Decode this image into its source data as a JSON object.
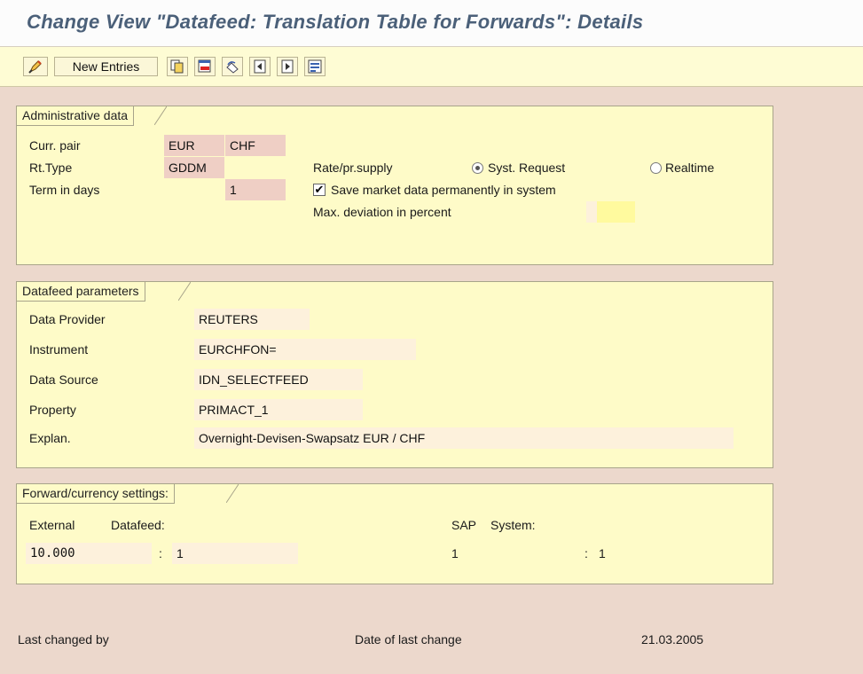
{
  "title": "Change View \"Datafeed: Translation Table for Forwards\": Details",
  "toolbar": {
    "new_entries_label": "New Entries",
    "icons": [
      "display-change-icon",
      "copy-icon",
      "delete-icon",
      "undo-icon",
      "previous-entry-icon",
      "next-entry-icon",
      "select-block-icon"
    ]
  },
  "admin": {
    "title": "Administrative data",
    "curr_pair_label": "Curr. pair",
    "curr_from": "EUR",
    "curr_to": "CHF",
    "rt_type_label": "Rt.Type",
    "rt_type_value": "GDDM",
    "term_label": "Term in days",
    "term_value": "1",
    "rate_supply_label": "Rate/pr.supply",
    "syst_request_label": "Syst. Request",
    "realtime_label": "Realtime",
    "syst_request_selected": true,
    "save_permanently_label": "Save market data permanently in system",
    "save_permanently_checked": true,
    "max_dev_label": "Max. deviation in percent",
    "max_dev_value": ""
  },
  "datafeed": {
    "title": "Datafeed parameters",
    "provider_label": "Data Provider",
    "provider_value": "REUTERS",
    "instrument_label": "Instrument",
    "instrument_value": "EURCHFON=",
    "source_label": "Data Source",
    "source_value": "IDN_SELECTFEED",
    "property_label": "Property",
    "property_value": "PRIMACT_1",
    "explan_label": "Explan.",
    "explan_value": "Overnight-Devisen-Swapsatz EUR / CHF"
  },
  "forward": {
    "title": "Forward/currency settings:",
    "external_label": "External",
    "datafeed_label": "Datafeed:",
    "sap_label": "SAP",
    "system_label": "System:",
    "ext_value": "10.000",
    "ext_sep": ":",
    "ext_ratio": "1",
    "sap_value": "1",
    "sap_sep": ":",
    "sap_ratio": "1"
  },
  "footer": {
    "last_changed_label": "Last changed by",
    "last_changed_value": "",
    "date_label": "Date of last change",
    "date_value": "21.03.2005"
  }
}
